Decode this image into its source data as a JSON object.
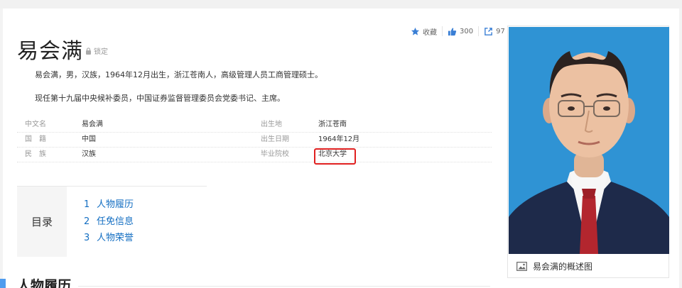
{
  "header": {
    "title": "易会满",
    "lock_label": "锁定"
  },
  "tools": {
    "collect_label": "收藏",
    "like_count": "300",
    "share_count": "97"
  },
  "summary": [
    "易会满，男，汉族，1964年12月出生，浙江苍南人，高级管理人员工商管理硕士。",
    "现任第十九届中央候补委员，中国证券监督管理委员会党委书记、主席。"
  ],
  "basic_info": {
    "rows": [
      {
        "k1": "中文名",
        "v1": "易会满",
        "k2": "出生地",
        "v2": "浙江苍南"
      },
      {
        "k1": "国　籍",
        "v1": "中国",
        "k2": "出生日期",
        "v2": "1964年12月"
      },
      {
        "k1": "民　族",
        "v1": "汉族",
        "k2": "毕业院校",
        "v2": "北京大学"
      }
    ]
  },
  "toc": {
    "label": "目录",
    "items": [
      {
        "num": "1",
        "label": "人物履历"
      },
      {
        "num": "2",
        "label": "任免信息"
      },
      {
        "num": "3",
        "label": "人物荣誉"
      }
    ]
  },
  "section": {
    "title": "人物履历"
  },
  "photo": {
    "caption": "易会满的概述图",
    "background": "#2f93d4"
  },
  "colors": {
    "link": "#136ec2",
    "highlight": "#e02020",
    "section_bar": "#4f9cee"
  }
}
